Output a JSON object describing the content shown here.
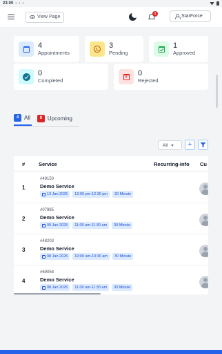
{
  "status_bar": {
    "time": "23:00",
    "status_icons": "• • •"
  },
  "topbar": {
    "view_page_label": "View Page",
    "notification_count": "1",
    "user_label": "StarForce"
  },
  "stats": [
    {
      "count": "4",
      "label": "Appointments",
      "icon": "calendar-icon",
      "color": "#dbeafe"
    },
    {
      "count": "3",
      "label": "Pending",
      "icon": "clock-icon",
      "color": "#fde68a"
    },
    {
      "count": "1",
      "label": "Approved",
      "icon": "calendar-check-icon",
      "color": "#dcfce7"
    },
    {
      "count": "0",
      "label": "Completed",
      "icon": "check-circle-icon",
      "color": "#cffafe"
    },
    {
      "count": "0",
      "label": "Rejected",
      "icon": "calendar-x-icon",
      "color": "#fee2e2"
    }
  ],
  "tabs": [
    {
      "count": "4",
      "label": "All",
      "active": true
    },
    {
      "count": "0",
      "label": "Upcoming",
      "active": false
    }
  ],
  "filter": {
    "selected": "All",
    "add_symbol": "+"
  },
  "table": {
    "headers": [
      "#",
      "Service",
      "Recurring-info",
      "Cu"
    ],
    "rows": [
      {
        "no": "1",
        "id": "#49150",
        "service": "Demo Service",
        "date": "13 Jan 2025",
        "time": "12:00 pm-12:30 pm",
        "duration": "30 Minute"
      },
      {
        "no": "2",
        "id": "#07985",
        "service": "Demo Service",
        "date": "09 Jan 2025",
        "time": "11:00 am-11:30 am",
        "duration": "30 Minute"
      },
      {
        "no": "3",
        "id": "#48203",
        "service": "Demo Service",
        "date": "08 Jan 2025",
        "time": "10:00 am-10:30 am",
        "duration": "30 Minute"
      },
      {
        "no": "4",
        "id": "#69058",
        "service": "Demo Service",
        "date": "08 Jan 2025",
        "time": "11:00 am-11:30 am",
        "duration": "30 Minute"
      }
    ]
  },
  "colors": {
    "accent": "#2563eb",
    "danger": "#dc2626"
  }
}
